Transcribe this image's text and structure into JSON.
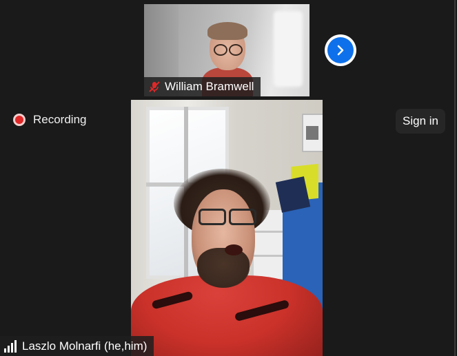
{
  "top_participant": {
    "name": "William Bramwell",
    "muted": true,
    "mute_icon": "microphone-muted-icon",
    "mute_icon_color": "#e02828"
  },
  "next_button": {
    "icon": "chevron-right-icon",
    "color": "#0e71eb"
  },
  "recording": {
    "label": "Recording",
    "icon": "recording-dot-icon",
    "color": "#e02828"
  },
  "sign_in": {
    "label": "Sign in"
  },
  "main_participant": {
    "name": "Laszlo Molnarfi (he,him)",
    "signal_icon": "signal-strength-icon"
  }
}
